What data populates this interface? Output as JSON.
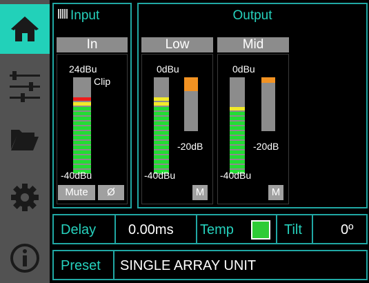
{
  "sidebar": {
    "items": [
      {
        "name": "home"
      },
      {
        "name": "eq"
      },
      {
        "name": "folder"
      },
      {
        "name": "settings"
      },
      {
        "name": "info"
      }
    ]
  },
  "input": {
    "title": "Input",
    "channel": "In",
    "top_label": "24dBu",
    "clip_label": "Clip",
    "bottom_label": "-40dBu",
    "mute_label": "Mute",
    "phase_label": "Ø",
    "level_fraction": 0.82
  },
  "output": {
    "title": "Output",
    "channels": [
      {
        "name": "Low",
        "top_label": "0dBu",
        "bottom_label": "-40dBu",
        "gr_label": "-20dB",
        "mute_label": "M",
        "level_fraction": 0.82,
        "gr_fraction": 0.25
      },
      {
        "name": "Mid",
        "top_label": "0dBu",
        "bottom_label": "-40dBu",
        "gr_label": "-20dB",
        "mute_label": "M",
        "level_fraction": 0.72,
        "gr_fraction": 0.1
      }
    ]
  },
  "controls": {
    "delay_label": "Delay",
    "delay_value": "0.00ms",
    "temp_label": "Temp",
    "temp_on": true,
    "tilt_label": "Tilt",
    "tilt_value": "0º"
  },
  "preset": {
    "label": "Preset",
    "value": "SINGLE ARRAY UNIT"
  },
  "colors": {
    "accent": "#20a8a4",
    "meter_green": "#22dd33",
    "meter_yellow": "#f2ea2a",
    "meter_red": "#ee1c1c",
    "gr_orange": "#f29222"
  }
}
